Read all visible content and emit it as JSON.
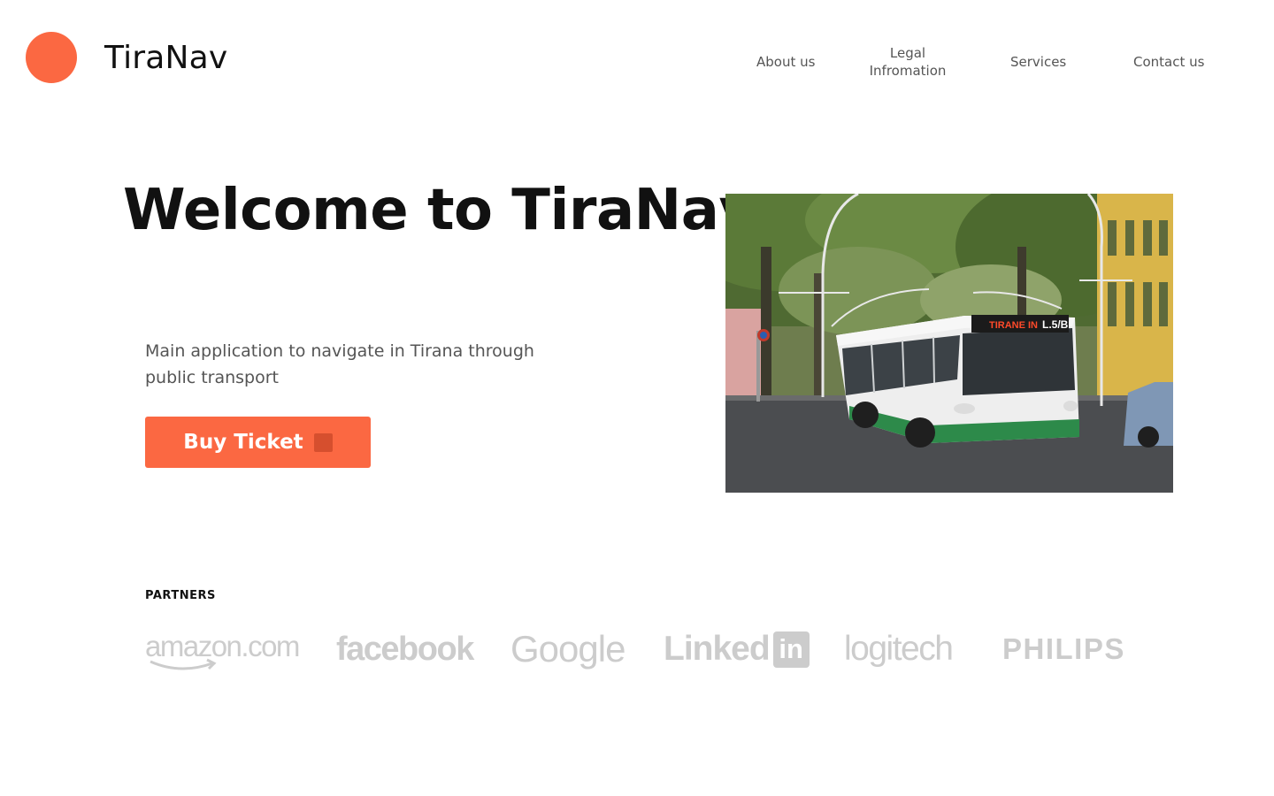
{
  "brand": {
    "name": "TiraNav",
    "accent_color": "#FB6842",
    "logo_icon": "orange-circle-logo"
  },
  "nav": {
    "items": [
      {
        "label": "About us"
      },
      {
        "label": "Legal Infromation"
      },
      {
        "label": "Services"
      },
      {
        "label": "Contact us"
      }
    ]
  },
  "hero": {
    "title": "Welcome to TiraNav",
    "description": "Main application to navigate in Tirana through public transport",
    "cta_label": "Buy Ticket",
    "cta_icon": "ticket-icon",
    "image": {
      "bus_destination_sign": "TIRANE IN",
      "bus_route": "L.5/B"
    }
  },
  "partners": {
    "heading": "PARTNERS",
    "logos": [
      {
        "name": "amazon.com",
        "icon": "amazon-logo"
      },
      {
        "name": "facebook",
        "icon": "facebook-logo"
      },
      {
        "name": "Google",
        "icon": "google-logo"
      },
      {
        "name": "Linked",
        "badge": "in",
        "icon": "linkedin-logo"
      },
      {
        "name": "logitech",
        "icon": "logitech-logo"
      },
      {
        "name": "PHILIPS",
        "icon": "philips-logo"
      }
    ],
    "logo_color": "#cccccc"
  }
}
